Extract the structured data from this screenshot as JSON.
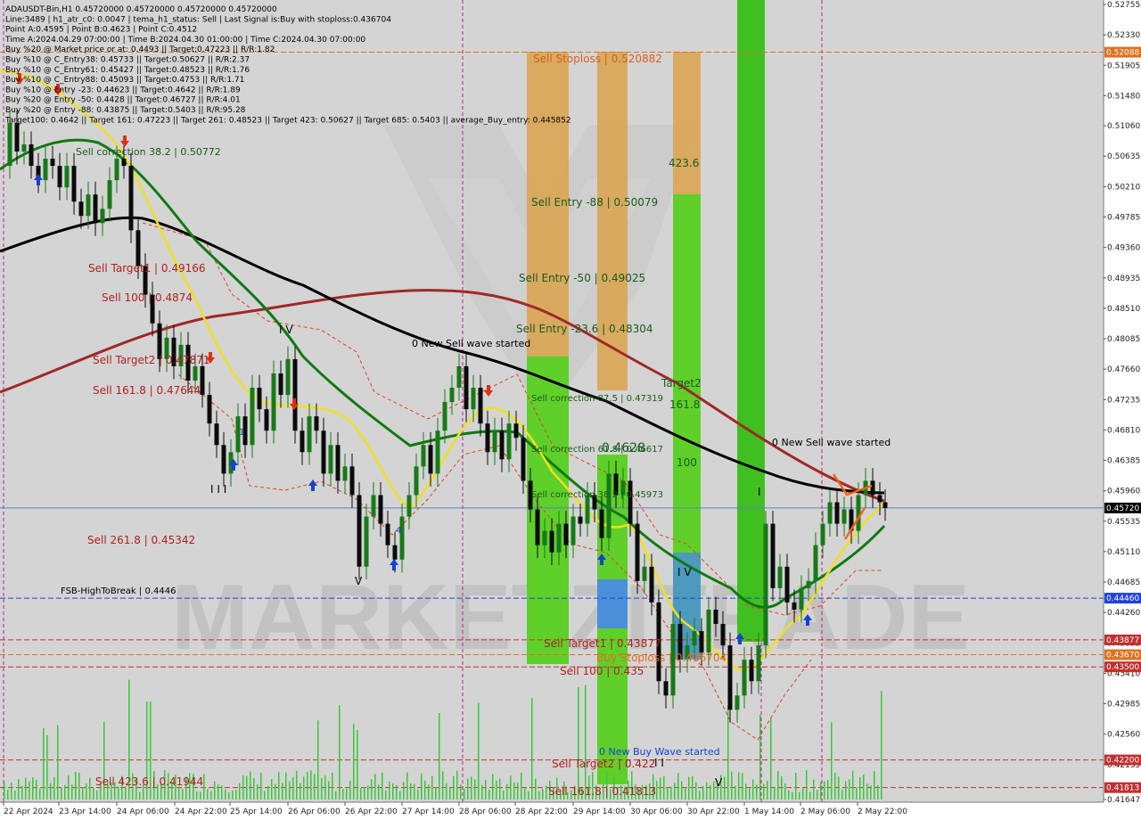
{
  "window": {
    "bg": "#d4d4d4",
    "bull": "#177a17",
    "bear": "#0b0b0b"
  },
  "info_lines": [
    "ADAUSDT-Bin,H1  0.45720000 0.45720000 0.45720000 0.45720000",
    "Line:3489 | h1_atr_c0: 0.0047 | tema_h1_status: Sell | Last Signal is:Buy with stoploss:0.436704",
    "Point A:0.4595 | Point B:0.4623 | Point C:0.4512",
    "Time A:2024.04.29 07:00:00 | Time B:2024.04.30 01:00:00 | Time C:2024.04.30 07:00:00",
    "Buy %20 @ Market price or at: 0.4493 || Target:0.47223 || R/R:1.82",
    "Buy %10 @ C_Entry38: 0.45733 || Target:0.50627 || R/R:2.37",
    "Buy %10 @ C_Entry61: 0.45427 || Target:0.48523 || R/R:1.76",
    "Buy %10 @ C_Entry88: 0.45093 || Target:0.4753 || R/R:1.71",
    "Buy %10 @ Entry -23: 0.44623 || Target:0.4642 || R/R:1.89",
    "Buy %20 @ Entry -50: 0.4428 || Target:0.46727 || R/R:4.01",
    "Buy %20 @ Entry -88: 0.43875 || Target:0.5403 || R/R:95.28",
    "Target100: 0.4642 || Target 161: 0.47223 || Target 261: 0.48523 || Target 423: 0.50627 || Target 685: 0.5403 || average_Buy_entry: 0.445852"
  ],
  "watermark": "MARKETZITRADE",
  "annotations": {
    "sell_stoploss": "Sell Stoploss | 0.520882",
    "v_423": "423.6",
    "sell_entry_88": "Sell Entry -88 | 0.50079",
    "sell_entry_50": "Sell Entry -50 | 0.49025",
    "sell_entry_23": "Sell Entry -23.6 | 0.48304",
    "sell_corr_875": "Sell correction 87.5 | 0.47319",
    "target2": "Target2",
    "v_161": "161.8",
    "sell_corr_618": "Sell correction 61.8 | 0.46617",
    "v_100": "100",
    "sell_corr_382": "Sell correction 38.2 | 0.45973",
    "v_4628": "0.4628",
    "new_sell_1": "0 New Sell wave started",
    "new_sell_2": "0 New Sell wave started",
    "sell_target1_top": "Sell Target1 | 0.49166",
    "sell_100_top": "Sell 100 | 0.4874",
    "sell_target2_top": "Sell Target2 | 0.47871",
    "sell_161_top": "Sell 161.8 | 0.47644",
    "sell_261_top": "Sell  261.8 | 0.45342",
    "sell_423_top": "Sell  423.6 | 0.41944",
    "sell_corr_382_top": "Sell correction 38.2 | 0.50772",
    "fsb": "FSB-HighToBreak  |  0.4446",
    "sell_target1_bot": "Sell Target1 | 0.43877",
    "buy_stoploss": "Buy Stoploss | 0.436704",
    "sell_100_bot": "Sell 100 | 0.435",
    "new_buy": "0 New Buy Wave started",
    "sell_target2_bot": "Sell Target2 | 0.422",
    "sell_161_bot": "Sell 161.8 | 0.41813",
    "wave_iii": "I I I",
    "wave_iv": "I V",
    "wave_v": "V",
    "wave_v2": "V",
    "wave_iv2": "I V",
    "wave_i": "I",
    "wave_ii": "I I",
    "mark_1": "1",
    "mark_4": "4"
  },
  "chart_data": {
    "type": "candlestick",
    "symbol": "ADAUSDT-Bin,H1",
    "ylim": [
      0.41647,
      0.52755
    ],
    "y_ticks": [
      "0.52755",
      "0.52330",
      "0.51905",
      "0.51480",
      "0.51060",
      "0.50635",
      "0.50210",
      "0.49785",
      "0.49360",
      "0.48935",
      "0.48510",
      "0.48085",
      "0.47660",
      "0.47235",
      "0.46810",
      "0.46385",
      "0.45960",
      "0.45535",
      "0.45110",
      "0.44685",
      "0.44260",
      "0.43835",
      "0.43410",
      "0.42985",
      "0.42560",
      "0.42135",
      "0.41647"
    ],
    "x_ticks": [
      "22 Apr 2024",
      "23 Apr 14:00",
      "24 Apr 06:00",
      "24 Apr 22:00",
      "25 Apr 14:00",
      "26 Apr 06:00",
      "26 Apr 22:00",
      "27 Apr 14:00",
      "28 Apr 06:00",
      "28 Apr 22:00",
      "29 Apr 14:00",
      "30 Apr 06:00",
      "30 Apr 22:00",
      "1 May 14:00",
      "2 May 06:00",
      "2 May 22:00"
    ],
    "price_tags": [
      {
        "value": 0.52088,
        "text": "0.52088",
        "color": "#e07020"
      },
      {
        "value": 0.4572,
        "text": "0.45720",
        "color": "#000000"
      },
      {
        "value": 0.4446,
        "text": "0.44460",
        "color": "#2040e0"
      },
      {
        "value": 0.43877,
        "text": "0.43877",
        "color": "#c03030"
      },
      {
        "value": 0.4367,
        "text": "0.43670",
        "color": "#e07020"
      },
      {
        "value": 0.435,
        "text": "0.43500",
        "color": "#c03030"
      },
      {
        "value": 0.422,
        "text": "0.42200",
        "color": "#c03030"
      },
      {
        "value": 0.41813,
        "text": "0.41813",
        "color": "#c03030"
      }
    ],
    "key_levels": [
      {
        "value": 0.52088,
        "color": "#e07020",
        "style": "dash"
      },
      {
        "value": 0.4572,
        "color": "#6080c0",
        "style": "solid"
      },
      {
        "value": 0.4446,
        "color": "#2040e0",
        "style": "dash"
      },
      {
        "value": 0.43877,
        "color": "#c03030",
        "style": "dash"
      },
      {
        "value": 0.4367,
        "color": "#e07020",
        "style": "dash"
      },
      {
        "value": 0.435,
        "color": "#c03030",
        "style": "dash"
      },
      {
        "value": 0.422,
        "color": "#c03030",
        "style": "dash"
      },
      {
        "value": 0.41813,
        "color": "#c03030",
        "style": "dash"
      }
    ],
    "close_path": [
      [
        0,
        0.505
      ],
      [
        8,
        0.511
      ],
      [
        16,
        0.507
      ],
      [
        24,
        0.508
      ],
      [
        32,
        0.505
      ],
      [
        40,
        0.503
      ],
      [
        48,
        0.506
      ],
      [
        56,
        0.505
      ],
      [
        64,
        0.502
      ],
      [
        72,
        0.505
      ],
      [
        80,
        0.5
      ],
      [
        88,
        0.498
      ],
      [
        96,
        0.501
      ],
      [
        104,
        0.497
      ],
      [
        112,
        0.499
      ],
      [
        120,
        0.503
      ],
      [
        128,
        0.506
      ],
      [
        136,
        0.505
      ],
      [
        144,
        0.496
      ],
      [
        152,
        0.491
      ],
      [
        160,
        0.487
      ],
      [
        168,
        0.483
      ],
      [
        176,
        0.478
      ],
      [
        184,
        0.481
      ],
      [
        192,
        0.477
      ],
      [
        200,
        0.48
      ],
      [
        208,
        0.475
      ],
      [
        216,
        0.477
      ],
      [
        224,
        0.473
      ],
      [
        232,
        0.469
      ],
      [
        240,
        0.466
      ],
      [
        248,
        0.462
      ],
      [
        256,
        0.465
      ],
      [
        264,
        0.47
      ],
      [
        272,
        0.466
      ],
      [
        280,
        0.474
      ],
      [
        288,
        0.471
      ],
      [
        296,
        0.468
      ],
      [
        304,
        0.476
      ],
      [
        312,
        0.473
      ],
      [
        320,
        0.478
      ],
      [
        328,
        0.468
      ],
      [
        336,
        0.465
      ],
      [
        344,
        0.47
      ],
      [
        352,
        0.468
      ],
      [
        360,
        0.462
      ],
      [
        368,
        0.466
      ],
      [
        376,
        0.461
      ],
      [
        384,
        0.463
      ],
      [
        392,
        0.459
      ],
      [
        400,
        0.449
      ],
      [
        408,
        0.456
      ],
      [
        416,
        0.459
      ],
      [
        424,
        0.455
      ],
      [
        432,
        0.452
      ],
      [
        440,
        0.45
      ],
      [
        448,
        0.456
      ],
      [
        456,
        0.459
      ],
      [
        464,
        0.463
      ],
      [
        472,
        0.466
      ],
      [
        480,
        0.462
      ],
      [
        488,
        0.468
      ],
      [
        496,
        0.472
      ],
      [
        504,
        0.474
      ],
      [
        512,
        0.477
      ],
      [
        520,
        0.471
      ],
      [
        528,
        0.474
      ],
      [
        536,
        0.469
      ],
      [
        544,
        0.465
      ],
      [
        552,
        0.468
      ],
      [
        560,
        0.464
      ],
      [
        568,
        0.469
      ],
      [
        576,
        0.467
      ],
      [
        584,
        0.461
      ],
      [
        592,
        0.457
      ],
      [
        600,
        0.452
      ],
      [
        608,
        0.454
      ],
      [
        616,
        0.451
      ],
      [
        624,
        0.455
      ],
      [
        632,
        0.452
      ],
      [
        640,
        0.456
      ],
      [
        648,
        0.455
      ],
      [
        656,
        0.459
      ],
      [
        664,
        0.457
      ],
      [
        672,
        0.453
      ],
      [
        680,
        0.462
      ],
      [
        688,
        0.459
      ],
      [
        696,
        0.461
      ],
      [
        704,
        0.455
      ],
      [
        712,
        0.447
      ],
      [
        720,
        0.449
      ],
      [
        728,
        0.444
      ],
      [
        736,
        0.433
      ],
      [
        744,
        0.431
      ],
      [
        752,
        0.441
      ],
      [
        760,
        0.436
      ],
      [
        768,
        0.438
      ],
      [
        776,
        0.44
      ],
      [
        784,
        0.437
      ],
      [
        792,
        0.443
      ],
      [
        800,
        0.441
      ],
      [
        808,
        0.438
      ],
      [
        816,
        0.429
      ],
      [
        824,
        0.431
      ],
      [
        832,
        0.436
      ],
      [
        840,
        0.433
      ],
      [
        848,
        0.438
      ],
      [
        856,
        0.455
      ],
      [
        864,
        0.446
      ],
      [
        872,
        0.449
      ],
      [
        880,
        0.444
      ],
      [
        888,
        0.443
      ],
      [
        896,
        0.446
      ],
      [
        904,
        0.447
      ],
      [
        912,
        0.452
      ],
      [
        920,
        0.455
      ],
      [
        928,
        0.458
      ],
      [
        936,
        0.455
      ],
      [
        944,
        0.457
      ],
      [
        952,
        0.454
      ],
      [
        960,
        0.459
      ],
      [
        968,
        0.461
      ],
      [
        976,
        0.459
      ],
      [
        984,
        0.458
      ],
      [
        990,
        0.4572
      ]
    ]
  }
}
